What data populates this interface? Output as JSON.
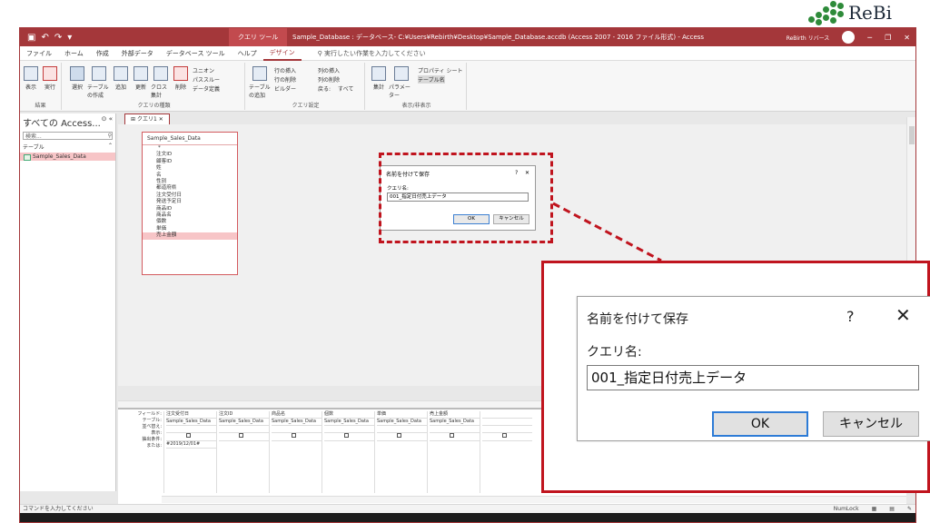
{
  "logo": {
    "text": "ReBi"
  },
  "titlebar": {
    "tool_tab": "クエリ ツール",
    "title": "Sample_Database : データベース- C:¥Users¥Rebirth¥Desktop¥Sample_Database.accdb (Access 2007 - 2016 ファイル形式) - Access",
    "user": "ReBirth リバース"
  },
  "menu": {
    "items": [
      "ファイル",
      "ホーム",
      "作成",
      "外部データ",
      "データベース ツール",
      "ヘルプ",
      "デザイン"
    ],
    "tell_me": "実行したい作業を入力してください"
  },
  "ribbon": {
    "results": {
      "view": "表示",
      "run": "実行",
      "group": "結果"
    },
    "query_type": {
      "select": "選択",
      "make_table": "テーブルの作成",
      "append": "追加",
      "update": "更新",
      "crosstab": "クロス集計",
      "delete": "削除",
      "union": "ユニオン",
      "passthrough": "パススルー",
      "data_def": "データ定義",
      "group": "クエリの種類"
    },
    "setup": {
      "add_table": "テーブルの追加",
      "insert_rows": "行の挿入",
      "delete_rows": "行の削除",
      "builder": "ビルダー",
      "insert_cols": "列の挿入",
      "delete_cols": "列の削除",
      "return": "戻る:",
      "return_value": "すべて",
      "group": "クエリ設定"
    },
    "showhide": {
      "totals": "集計",
      "params": "パラメーター",
      "property_sheet": "プロパティ シート",
      "table_names": "テーブル名",
      "group": "表示/非表示"
    }
  },
  "nav": {
    "header": "すべての Access...",
    "search_placeholder": "検索...",
    "category": "テーブル",
    "items": [
      "Sample_Sales_Data"
    ]
  },
  "doc_tab": {
    "label": "クエリ1"
  },
  "table_box": {
    "title": "Sample_Sales_Data",
    "fields": [
      "*",
      "注文ID",
      "顧客ID",
      "姓",
      "名",
      "性別",
      "都道府県",
      "注文受付日",
      "発送予定日",
      "商品ID",
      "商品名",
      "個数",
      "単価",
      "売上金額"
    ]
  },
  "grid": {
    "row_labels": [
      "フィールド:",
      "テーブル:",
      "並べ替え:",
      "表示:",
      "抽出条件:",
      "または:"
    ],
    "columns": [
      {
        "field": "注文受付日",
        "table": "Sample_Sales_Data",
        "criteria": "#2019/12/01#"
      },
      {
        "field": "注文ID",
        "table": "Sample_Sales_Data",
        "criteria": ""
      },
      {
        "field": "商品名",
        "table": "Sample_Sales_Data",
        "criteria": ""
      },
      {
        "field": "個数",
        "table": "Sample_Sales_Data",
        "criteria": ""
      },
      {
        "field": "単価",
        "table": "Sample_Sales_Data",
        "criteria": ""
      },
      {
        "field": "売上金額",
        "table": "Sample_Sales_Data",
        "criteria": ""
      },
      {
        "field": "",
        "table": "",
        "criteria": ""
      }
    ]
  },
  "status": {
    "left": "コマンドを入力してください",
    "numlock": "NumLock"
  },
  "dialog": {
    "title": "名前を付けて保存",
    "help": "?",
    "close": "✕",
    "label": "クエリ名:",
    "value": "001_指定日付売上データ",
    "ok": "OK",
    "cancel": "キャンセル"
  }
}
